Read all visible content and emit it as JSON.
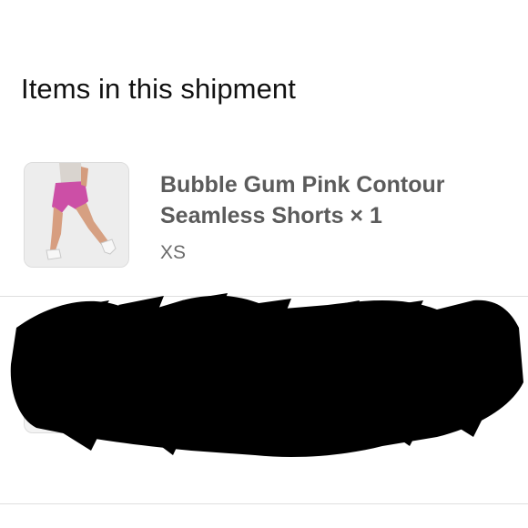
{
  "heading": "Items in this shipment",
  "items": [
    {
      "title_line1": "Bubble Gum Pink Contour",
      "title_line2": "Seamless Shorts × 1",
      "variant": "XS",
      "thumbnail": "product-photo-pink-shorts"
    },
    {
      "redacted": true,
      "thumbnail": "product-photo"
    }
  ]
}
